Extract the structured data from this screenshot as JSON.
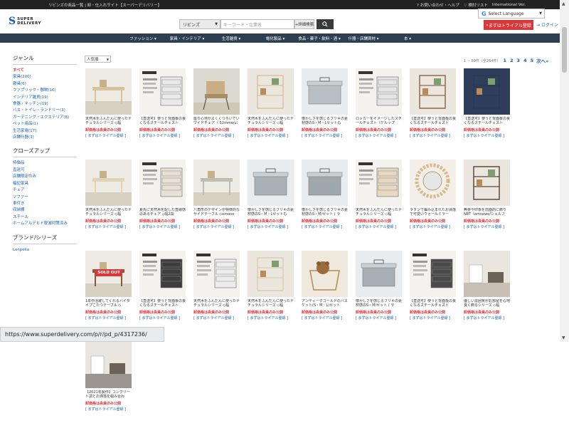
{
  "topbar": {
    "title": "リビンズの商品一覧 | 卸・仕入れサイト【スーパーデリバリー】",
    "help": "お問い合わせ・ヘルプ",
    "wishlist": "検討リスト",
    "intl": "International Ver."
  },
  "translate": {
    "label": "Select Language"
  },
  "header": {
    "logo_line1": "SUPER",
    "logo_line2": "DELIVERY",
    "search_scope": "リビンズ",
    "search_placeholder": "キーワード・企業名",
    "advanced_search": "+詳細検索",
    "trial_button": "まずはトライアル登録",
    "login": "ログイン"
  },
  "nav": {
    "items": [
      "ファッション ▾",
      "家具・インテリア ▾",
      "生活雑貨 ▾",
      "電化製品 ▾",
      "食品・菓子・飲料・酒 ▾",
      "什器・店舗資材 ▾",
      "本 ▾"
    ]
  },
  "sidebar": {
    "genre_title": "ジャンル",
    "genres": [
      "すべて",
      "家具(200)",
      "寝具(6)",
      "ファブリック・敷物(16)",
      "インテリア雑貨(19)",
      "食器・キッチン(19)",
      "バス・トイレ・ランドリー(3)",
      "ガーデニング・エクステリア(8)",
      "ペット用品(1)",
      "生活家電(17)",
      "店舗什器(3)"
    ],
    "closeup_title": "クローズアップ",
    "closeups": [
      "特価品",
      "直送可",
      "店舗限定のみ",
      "幅記家具",
      "チェア",
      "ソファー",
      "車付き",
      "収納棚",
      "スチール",
      "ホームアルデヒド軽減対策済み"
    ],
    "brand_title": "ブランド/シリーズ",
    "brands": [
      "Lonpeka"
    ]
  },
  "toolbar": {
    "sort": "人気順",
    "count_text": "1 ~ 60件（全264件）",
    "pages": [
      "1",
      "2",
      "3",
      "4",
      "5"
    ],
    "next": "次へ»"
  },
  "common": {
    "price_label": "卸価格は会員のみ公開",
    "cta_label": "[ まずはトライアル登録 ]"
  },
  "products": [
    {
      "name": "天然木をふんだんに使ったナチュラルシリーズ ◇幅",
      "icon": "desk-photo",
      "color": "#d8c29a",
      "sold_out": ""
    },
    {
      "name": "【直送可】使うと背面板の良くなるスチールチェスト",
      "icon": "catalog-photo",
      "color": "#e9e9e9",
      "sold_out": ""
    },
    {
      "name": "座り心地がよくくつろいでいワイドチェア（ 52mmo/u）",
      "icon": "chair-photo",
      "color": "#c9ad84",
      "sold_out": ""
    },
    {
      "name": "天然木をふんだんに使ったナチュラルシリーズ ◇幅",
      "icon": "shelf-photo",
      "color": "#d6c49d",
      "sold_out": ""
    },
    {
      "name": "懐かしさを感じるブリキの素材感のS・M・Lセットも",
      "icon": "tin-box-photo",
      "color": "#b8c0c6",
      "sold_out": ""
    },
    {
      "name": "ロッカーをイメージしたスチールチェスト〈ケルップ",
      "icon": "catalog-photo",
      "color": "#e4e4e4",
      "sold_out": ""
    },
    {
      "name": "【直送可】使うと背面板の良くなるスチールチェスト",
      "icon": "cabinet-photo",
      "color": "#8a6b4c",
      "sold_out": ""
    },
    {
      "name": "【直送可】使うと背面板の良くなるスチールチェスト",
      "icon": "chest-photo",
      "color": "#2b3a55",
      "sold_out": ""
    },
    {
      "name": "天然木をふんだんに使ったナチュラルシリーズ ◇幅",
      "icon": "desk-photo",
      "color": "#e3d3b6",
      "sold_out": ""
    },
    {
      "name": "夏先に天然木を配した直線感のあるチェア ◇幅2段",
      "icon": "catalog-photo",
      "color": "#e7e0d4",
      "sold_out": ""
    },
    {
      "name": "八角形のデザインが特徴的なサイドテーブル ◇omono",
      "icon": "table-photo",
      "color": "#bdbdb0",
      "sold_out": ""
    },
    {
      "name": "懐かしさを感じるブリキの素材感のS・M・Lセットも",
      "icon": "tin-box-photo",
      "color": "#a7b1b6",
      "sold_out": ""
    },
    {
      "name": "懐かしさを感じるブリキの素材感のS・M/セット ( ラ",
      "icon": "tin-box-photo",
      "color": "#9fa8ad",
      "sold_out": ""
    },
    {
      "name": "天然木をふんだんに使ったナチュラルシリーズ ◇幅",
      "icon": "catalog-photo",
      "color": "#e6d8c3",
      "sold_out": ""
    },
    {
      "name": "ラタンで編み込まれたお洒落で可愛いウォールミラー",
      "icon": "mirror-photo",
      "color": "#d6b98d",
      "sold_out": ""
    },
    {
      "name": "無骨や印象を前面的に飾りNRT〈omnowo/シェルフ",
      "icon": "rack-photo",
      "color": "#5b4a3a",
      "sold_out": ""
    },
    {
      "name": "1年中活躍してくれるハイタイプこたつテーブル ◇",
      "icon": "table-photo",
      "color": "#8a5a36",
      "sold_out": "SOLD OUT"
    },
    {
      "name": "【直送可】使うと背面板の良くなるスチールチェスト",
      "icon": "catalog-photo",
      "color": "#3d3d3d",
      "sold_out": ""
    },
    {
      "name": "天然木をふんだんに使ったナチュラルシリーズ ◇幅",
      "icon": "catalog-photo",
      "color": "#ececec",
      "sold_out": ""
    },
    {
      "name": "天然木をふんだんに使ったナチュラルシリーズ ◇幅",
      "icon": "shelf-photo",
      "color": "#dacdb2",
      "sold_out": ""
    },
    {
      "name": "アンティークゴールドのバスケット(S・M・L)セット",
      "icon": "basket-photo",
      "color": "#b48a4c",
      "sold_out": ""
    },
    {
      "name": "懐かしさを感じるブリキの素材感のS・M/セット ( ラ",
      "icon": "tin-box-photo",
      "color": "#a6afb4",
      "sold_out": ""
    },
    {
      "name": "【直送可】使うと背面板の良くなるスチールチェスト",
      "icon": "catalog-photo",
      "color": "#4a4a4a",
      "sold_out": ""
    },
    {
      "name": "優しい雰囲気がお部屋を心地良く飾るシリーズ ◇幅",
      "icon": "room-photo",
      "color": "#c8c0b4",
      "sold_out": ""
    },
    {
      "name": "【2021年製作】コンクリート調とお洒落を組み合わ",
      "icon": "room-photo",
      "color": "#9a958e",
      "sold_out": ""
    }
  ],
  "status_url": "https://www.superdelivery.com/p/r/pd_p/4317236/"
}
